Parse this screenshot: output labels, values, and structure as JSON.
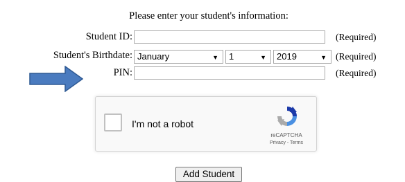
{
  "form": {
    "heading": "Please enter your student's information:",
    "student_id_label": "Student ID:",
    "student_id_value": "",
    "birthdate_label": "Student's Birthdate:",
    "month_value": "January",
    "day_value": "1",
    "year_value": "2019",
    "pin_label": "PIN:",
    "pin_value": "",
    "required_text": "(Required)",
    "submit_label": "Add Student"
  },
  "captcha": {
    "label": "I'm not a robot",
    "brand": "reCAPTCHA",
    "links": "Privacy - Terms"
  },
  "colors": {
    "arrow_fill": "#4a7bbf",
    "arrow_stroke": "#2f5a94",
    "captcha_blue": "#4a90e2"
  },
  "icons": {
    "pointer_arrow": "right-arrow-icon",
    "captcha_logo": "recaptcha-icon"
  }
}
